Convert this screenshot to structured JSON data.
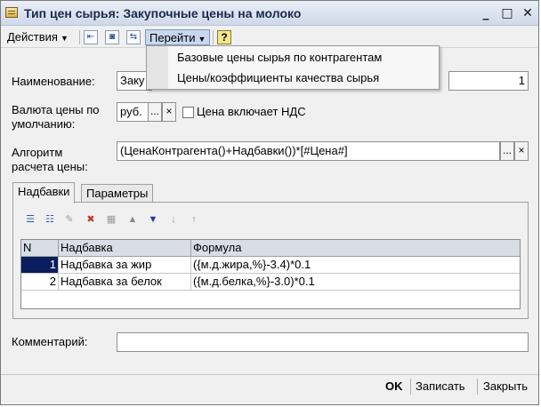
{
  "window": {
    "title": "Тип цен сырья: Закупочные цены на молоко",
    "minimize": "_",
    "maximize": "□",
    "close": "✕"
  },
  "toolbar": {
    "actions_label": "Действия",
    "goto_label": "Перейти",
    "help_label": "?"
  },
  "goto_menu": {
    "items": [
      {
        "label": "Базовые цены сырья по контрагентам"
      },
      {
        "label": "Цены/коэффициенты качества сырья"
      }
    ]
  },
  "form": {
    "name_label": "Наименование:",
    "name_value": "Заку",
    "code_value": "1",
    "currency_label_1": "Валюта цены по",
    "currency_label_2": "умолчанию:",
    "currency_value": "руб.",
    "vat_label": "Цена включает НДС",
    "algo_label_1": "Алгоритм",
    "algo_label_2": "расчета цены:",
    "algo_value": "(ЦенаКонтрагента()+Надбавки())*[#Цена#]",
    "comment_label": "Комментарий:",
    "comment_value": ""
  },
  "tabs": [
    {
      "label": "Надбавки"
    },
    {
      "label": "Параметры"
    }
  ],
  "grid": {
    "columns": [
      "N",
      "Надбавка",
      "Формула"
    ],
    "rows": [
      {
        "n": "1",
        "name": "Надбавка за жир",
        "formula": "({м.д.жира,%}-3.4)*0.1"
      },
      {
        "n": "2",
        "name": "Надбавка за белок",
        "formula": "({м.д.белка,%}-3.0)*0.1"
      }
    ]
  },
  "buttons": {
    "ok": "OK",
    "save": "Записать",
    "close": "Закрыть"
  },
  "icons": {
    "ellipsis": "...",
    "clear": "×",
    "dropdown_arrow": "▼"
  },
  "colors": {
    "title_bar": "#cfd9ea",
    "selected_cell": "#0a1d5c",
    "grid_header": "#d8dde6"
  }
}
